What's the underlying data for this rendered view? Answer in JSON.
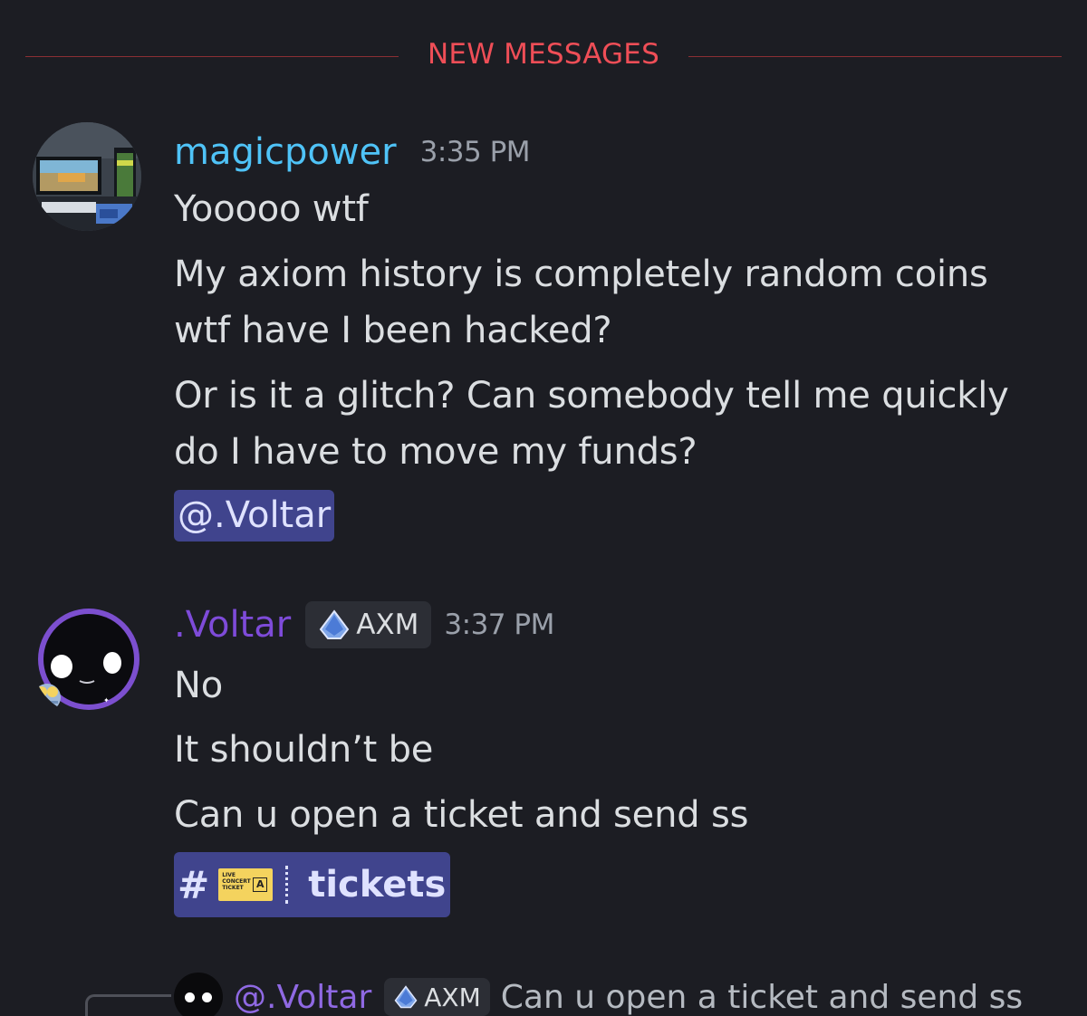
{
  "divider": {
    "label": "NEW MESSAGES"
  },
  "messages": [
    {
      "username": "magicpower",
      "timestamp": "3:35 PM",
      "lines": [
        "Yooooo wtf",
        "My axiom history is completely random coins",
        "wtf have I been hacked?",
        "Or is it a glitch? Can somebody tell me quickly",
        "do I have to move my funds?"
      ],
      "mention": "@.Voltar"
    },
    {
      "username": ".Voltar",
      "tag": "AXM",
      "timestamp": "3:37 PM",
      "lines": [
        "No",
        "It shouldn’t be",
        "Can u open a ticket and send ss"
      ],
      "channel": {
        "hash": "#",
        "name": "tickets"
      }
    }
  ],
  "reply": {
    "username": "@.Voltar",
    "tag": "AXM",
    "text": "Can u open a ticket and send ss"
  },
  "colors": {
    "background": "#1c1d23",
    "divider_red": "#ef4e57",
    "magicpower_name": "#4fc3f7",
    "voltar_name": "#7e4bd9",
    "mention_bg": "#40448d"
  }
}
